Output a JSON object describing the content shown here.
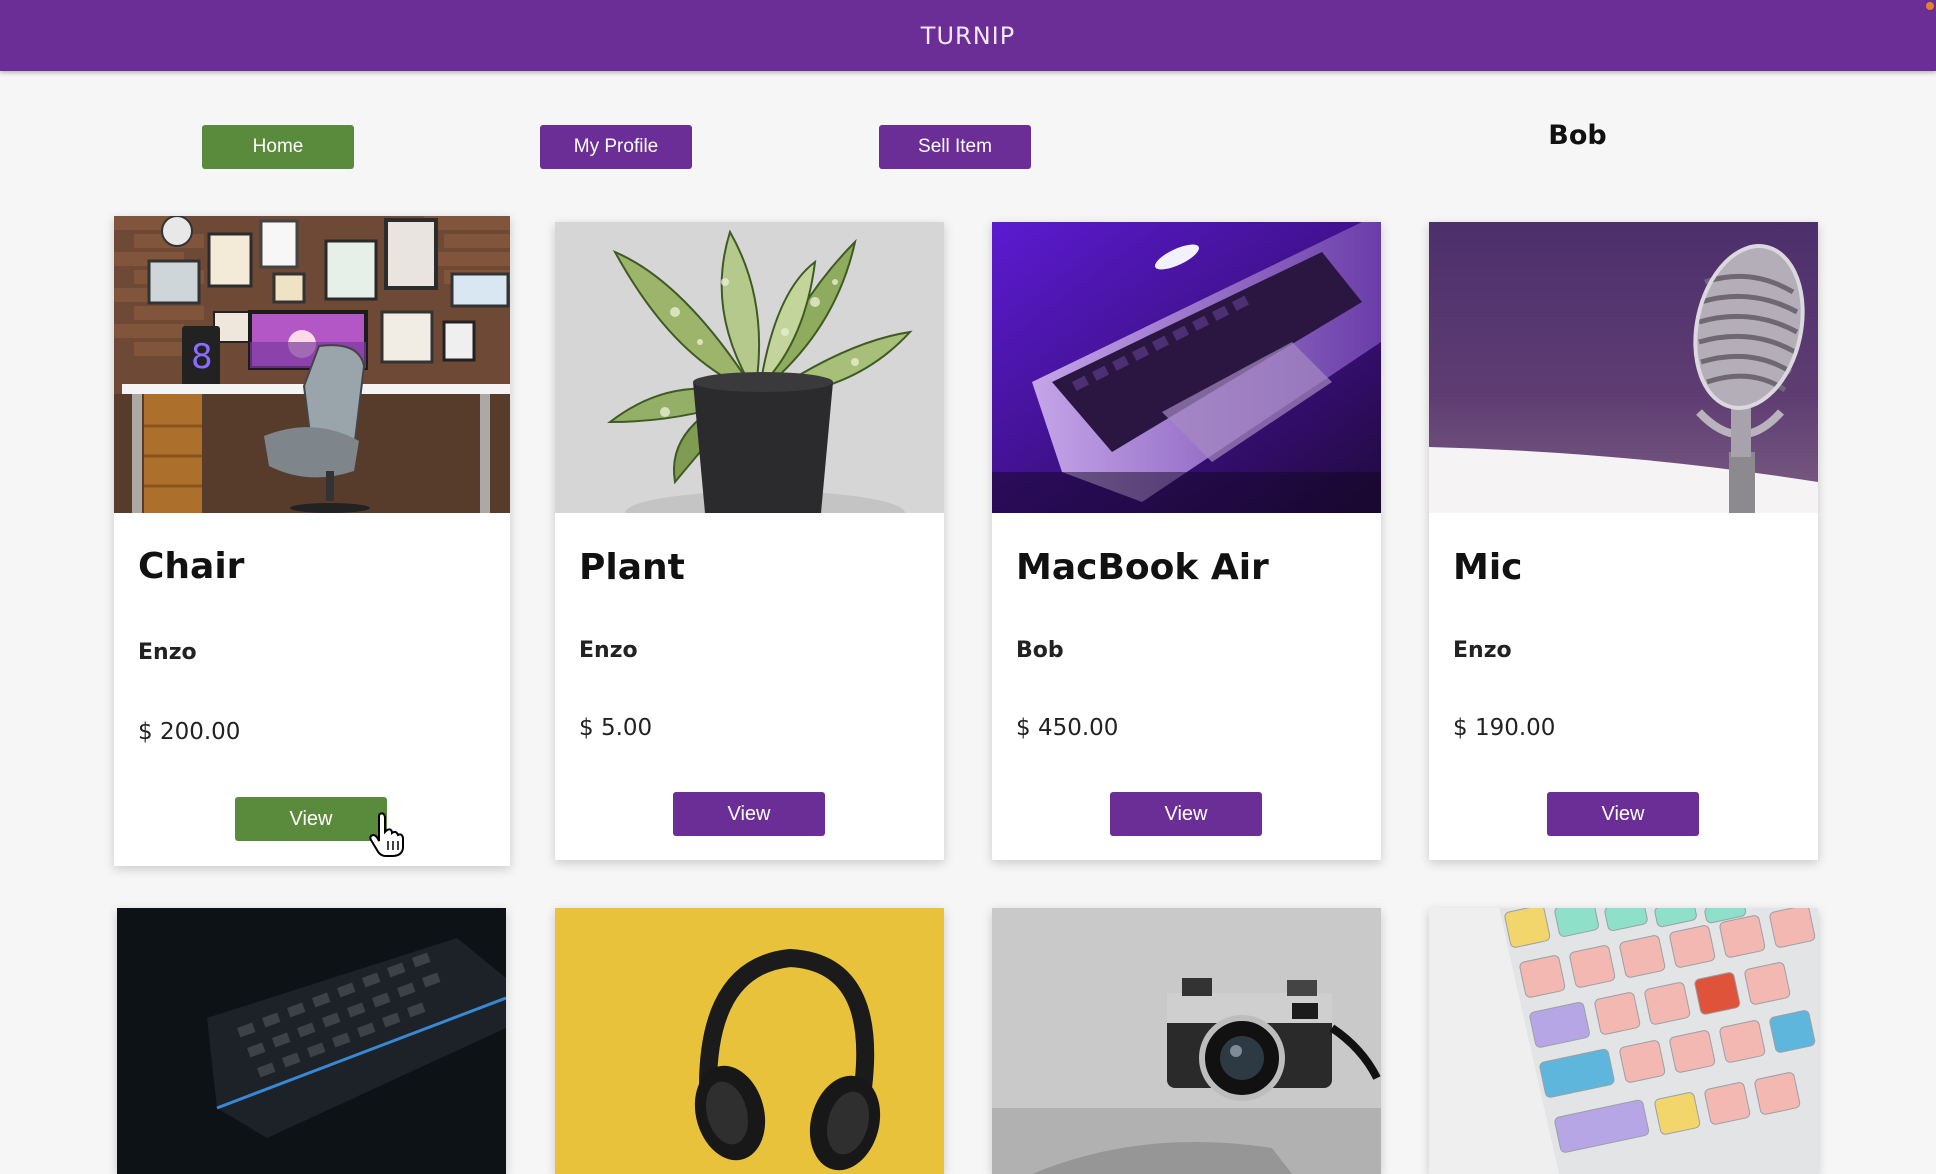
{
  "app": {
    "title": "TURNIP"
  },
  "nav": {
    "home": "Home",
    "profile": "My Profile",
    "sell": "Sell Item",
    "user": "Bob"
  },
  "colors": {
    "brand": "#6b2d96",
    "active": "#5a8a3c"
  },
  "products": [
    {
      "name": "Chair",
      "seller": "Enzo",
      "price": "$ 200.00",
      "view": "View",
      "image": "chair-desk-setup-photo"
    },
    {
      "name": "Plant",
      "seller": "Enzo",
      "price": "$ 5.00",
      "view": "View",
      "image": "potted-plant-photo"
    },
    {
      "name": "MacBook Air",
      "seller": "Bob",
      "price": "$ 450.00",
      "view": "View",
      "image": "laptop-photo"
    },
    {
      "name": "Mic",
      "seller": "Enzo",
      "price": "$ 190.00",
      "view": "View",
      "image": "microphone-photo"
    }
  ],
  "more_products": [
    {
      "image": "keyboard-photo"
    },
    {
      "image": "headphones-photo"
    },
    {
      "image": "camera-photo"
    },
    {
      "image": "colorful-keyboard-photo"
    }
  ]
}
